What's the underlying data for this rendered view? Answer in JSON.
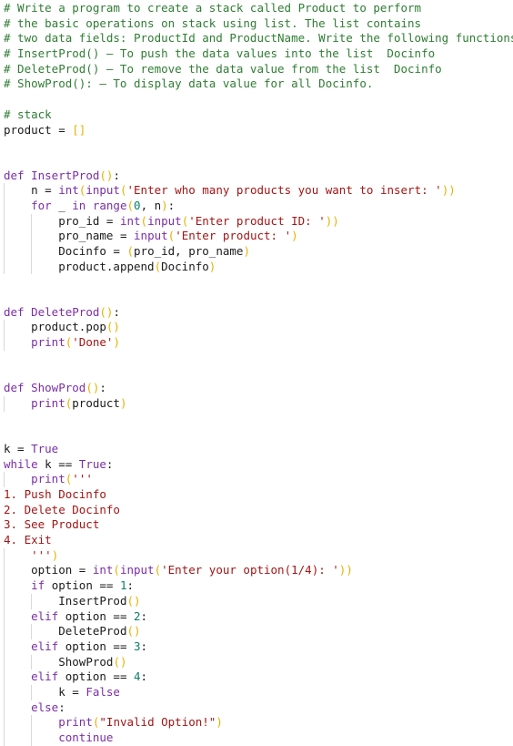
{
  "editor": {
    "colors": {
      "background": "#ffffff",
      "comment": "#2e7d32",
      "keyword": "#7b2ea8",
      "string": "#a31515",
      "number": "#0b7d6b",
      "bracket": "#e8b100",
      "text": "#1a1a1a",
      "indent_guide": "#d8d8d8"
    },
    "lines": [
      {
        "indent": 0,
        "tokens": [
          {
            "t": "comment",
            "v": "# Write a program to create a stack called Product to perform"
          }
        ]
      },
      {
        "indent": 0,
        "tokens": [
          {
            "t": "comment",
            "v": "# the basic operations on stack using list. The list contains"
          }
        ]
      },
      {
        "indent": 0,
        "tokens": [
          {
            "t": "comment",
            "v": "# two data fields: ProductId and ProductName. Write the following functions:"
          }
        ]
      },
      {
        "indent": 0,
        "tokens": [
          {
            "t": "comment",
            "v": "# InsertProd() – To push the data values into the list  Docinfo"
          }
        ]
      },
      {
        "indent": 0,
        "tokens": [
          {
            "t": "comment",
            "v": "# DeleteProd() – To remove the data value from the list  Docinfo"
          }
        ]
      },
      {
        "indent": 0,
        "tokens": [
          {
            "t": "comment",
            "v": "# ShowProd(): – To display data value for all Docinfo."
          }
        ]
      },
      {
        "indent": 0,
        "tokens": []
      },
      {
        "indent": 0,
        "tokens": [
          {
            "t": "comment",
            "v": "# stack"
          }
        ]
      },
      {
        "indent": 0,
        "tokens": [
          {
            "t": "name",
            "v": "product = "
          },
          {
            "t": "bracket",
            "v": "[]"
          }
        ]
      },
      {
        "indent": 0,
        "tokens": []
      },
      {
        "indent": 0,
        "tokens": []
      },
      {
        "indent": 0,
        "tokens": [
          {
            "t": "keyword",
            "v": "def "
          },
          {
            "t": "deffunc",
            "v": "InsertProd"
          },
          {
            "t": "bracket",
            "v": "()"
          },
          {
            "t": "name",
            "v": ":"
          }
        ]
      },
      {
        "indent": 1,
        "tokens": [
          {
            "t": "name",
            "v": "n = "
          },
          {
            "t": "builtin",
            "v": "int"
          },
          {
            "t": "bracket",
            "v": "("
          },
          {
            "t": "builtin",
            "v": "input"
          },
          {
            "t": "bracket",
            "v": "("
          },
          {
            "t": "string",
            "v": "'Enter who many products you want to insert: '"
          },
          {
            "t": "bracket",
            "v": "))"
          }
        ]
      },
      {
        "indent": 1,
        "tokens": [
          {
            "t": "keyword",
            "v": "for"
          },
          {
            "t": "name",
            "v": " _ "
          },
          {
            "t": "keyword",
            "v": "in"
          },
          {
            "t": "name",
            "v": " "
          },
          {
            "t": "builtin",
            "v": "range"
          },
          {
            "t": "bracket",
            "v": "("
          },
          {
            "t": "number",
            "v": "0"
          },
          {
            "t": "name",
            "v": ", n"
          },
          {
            "t": "bracket",
            "v": ")"
          },
          {
            "t": "name",
            "v": ":"
          }
        ]
      },
      {
        "indent": 2,
        "tokens": [
          {
            "t": "name",
            "v": "pro_id = "
          },
          {
            "t": "builtin",
            "v": "int"
          },
          {
            "t": "bracket",
            "v": "("
          },
          {
            "t": "builtin",
            "v": "input"
          },
          {
            "t": "bracket",
            "v": "("
          },
          {
            "t": "string",
            "v": "'Enter product ID: '"
          },
          {
            "t": "bracket",
            "v": "))"
          }
        ]
      },
      {
        "indent": 2,
        "tokens": [
          {
            "t": "name",
            "v": "pro_name = "
          },
          {
            "t": "builtin",
            "v": "input"
          },
          {
            "t": "bracket",
            "v": "("
          },
          {
            "t": "string",
            "v": "'Enter product: '"
          },
          {
            "t": "bracket",
            "v": ")"
          }
        ]
      },
      {
        "indent": 2,
        "tokens": [
          {
            "t": "name",
            "v": "Docinfo = "
          },
          {
            "t": "bracket",
            "v": "("
          },
          {
            "t": "name",
            "v": "pro_id, pro_name"
          },
          {
            "t": "bracket",
            "v": ")"
          }
        ]
      },
      {
        "indent": 2,
        "tokens": [
          {
            "t": "name",
            "v": "product.append"
          },
          {
            "t": "bracket",
            "v": "("
          },
          {
            "t": "name",
            "v": "Docinfo"
          },
          {
            "t": "bracket",
            "v": ")"
          }
        ]
      },
      {
        "indent": 0,
        "tokens": []
      },
      {
        "indent": 0,
        "tokens": []
      },
      {
        "indent": 0,
        "tokens": [
          {
            "t": "keyword",
            "v": "def "
          },
          {
            "t": "deffunc",
            "v": "DeleteProd"
          },
          {
            "t": "bracket",
            "v": "()"
          },
          {
            "t": "name",
            "v": ":"
          }
        ]
      },
      {
        "indent": 1,
        "tokens": [
          {
            "t": "name",
            "v": "product.pop"
          },
          {
            "t": "bracket",
            "v": "()"
          }
        ]
      },
      {
        "indent": 1,
        "tokens": [
          {
            "t": "builtin",
            "v": "print"
          },
          {
            "t": "bracket",
            "v": "("
          },
          {
            "t": "string",
            "v": "'Done'"
          },
          {
            "t": "bracket",
            "v": ")"
          }
        ]
      },
      {
        "indent": 0,
        "tokens": []
      },
      {
        "indent": 0,
        "tokens": []
      },
      {
        "indent": 0,
        "tokens": [
          {
            "t": "keyword",
            "v": "def "
          },
          {
            "t": "deffunc",
            "v": "ShowProd"
          },
          {
            "t": "bracket",
            "v": "()"
          },
          {
            "t": "name",
            "v": ":"
          }
        ]
      },
      {
        "indent": 1,
        "tokens": [
          {
            "t": "builtin",
            "v": "print"
          },
          {
            "t": "bracket",
            "v": "("
          },
          {
            "t": "name",
            "v": "product"
          },
          {
            "t": "bracket",
            "v": ")"
          }
        ]
      },
      {
        "indent": 0,
        "tokens": []
      },
      {
        "indent": 0,
        "tokens": []
      },
      {
        "indent": 0,
        "tokens": [
          {
            "t": "name",
            "v": "k = "
          },
          {
            "t": "keyword",
            "v": "True"
          }
        ]
      },
      {
        "indent": 0,
        "tokens": [
          {
            "t": "keyword",
            "v": "while"
          },
          {
            "t": "name",
            "v": " k == "
          },
          {
            "t": "keyword",
            "v": "True"
          },
          {
            "t": "name",
            "v": ":"
          }
        ]
      },
      {
        "indent": 1,
        "tokens": [
          {
            "t": "builtin",
            "v": "print"
          },
          {
            "t": "bracket",
            "v": "("
          },
          {
            "t": "string",
            "v": "'''"
          }
        ]
      },
      {
        "indent": 0,
        "tokens": [
          {
            "t": "string",
            "v": "1. Push Docinfo"
          }
        ]
      },
      {
        "indent": 0,
        "tokens": [
          {
            "t": "string",
            "v": "2. Delete Docinfo"
          }
        ]
      },
      {
        "indent": 0,
        "tokens": [
          {
            "t": "string",
            "v": "3. See Product"
          }
        ]
      },
      {
        "indent": 0,
        "tokens": [
          {
            "t": "string",
            "v": "4. Exit"
          }
        ]
      },
      {
        "indent": 1,
        "tokens": [
          {
            "t": "string",
            "v": "'''"
          },
          {
            "t": "bracket",
            "v": ")"
          }
        ]
      },
      {
        "indent": 1,
        "tokens": [
          {
            "t": "name",
            "v": "option = "
          },
          {
            "t": "builtin",
            "v": "int"
          },
          {
            "t": "bracket",
            "v": "("
          },
          {
            "t": "builtin",
            "v": "input"
          },
          {
            "t": "bracket",
            "v": "("
          },
          {
            "t": "string",
            "v": "'Enter your option(1/4): '"
          },
          {
            "t": "bracket",
            "v": "))"
          }
        ]
      },
      {
        "indent": 1,
        "tokens": [
          {
            "t": "keyword",
            "v": "if"
          },
          {
            "t": "name",
            "v": " option == "
          },
          {
            "t": "number",
            "v": "1"
          },
          {
            "t": "name",
            "v": ":"
          }
        ]
      },
      {
        "indent": 2,
        "tokens": [
          {
            "t": "name",
            "v": "InsertProd"
          },
          {
            "t": "bracket",
            "v": "()"
          }
        ]
      },
      {
        "indent": 1,
        "tokens": [
          {
            "t": "keyword",
            "v": "elif"
          },
          {
            "t": "name",
            "v": " option == "
          },
          {
            "t": "number",
            "v": "2"
          },
          {
            "t": "name",
            "v": ":"
          }
        ]
      },
      {
        "indent": 2,
        "tokens": [
          {
            "t": "name",
            "v": "DeleteProd"
          },
          {
            "t": "bracket",
            "v": "()"
          }
        ]
      },
      {
        "indent": 1,
        "tokens": [
          {
            "t": "keyword",
            "v": "elif"
          },
          {
            "t": "name",
            "v": " option == "
          },
          {
            "t": "number",
            "v": "3"
          },
          {
            "t": "name",
            "v": ":"
          }
        ]
      },
      {
        "indent": 2,
        "tokens": [
          {
            "t": "name",
            "v": "ShowProd"
          },
          {
            "t": "bracket",
            "v": "()"
          }
        ]
      },
      {
        "indent": 1,
        "tokens": [
          {
            "t": "keyword",
            "v": "elif"
          },
          {
            "t": "name",
            "v": " option == "
          },
          {
            "t": "number",
            "v": "4"
          },
          {
            "t": "name",
            "v": ":"
          }
        ]
      },
      {
        "indent": 2,
        "tokens": [
          {
            "t": "name",
            "v": "k = "
          },
          {
            "t": "keyword",
            "v": "False"
          }
        ]
      },
      {
        "indent": 1,
        "tokens": [
          {
            "t": "keyword",
            "v": "else"
          },
          {
            "t": "name",
            "v": ":"
          }
        ]
      },
      {
        "indent": 2,
        "tokens": [
          {
            "t": "builtin",
            "v": "print"
          },
          {
            "t": "bracket",
            "v": "("
          },
          {
            "t": "string",
            "v": "\"Invalid Option!\""
          },
          {
            "t": "bracket",
            "v": ")"
          }
        ]
      },
      {
        "indent": 2,
        "tokens": [
          {
            "t": "keyword",
            "v": "continue"
          }
        ]
      }
    ]
  }
}
